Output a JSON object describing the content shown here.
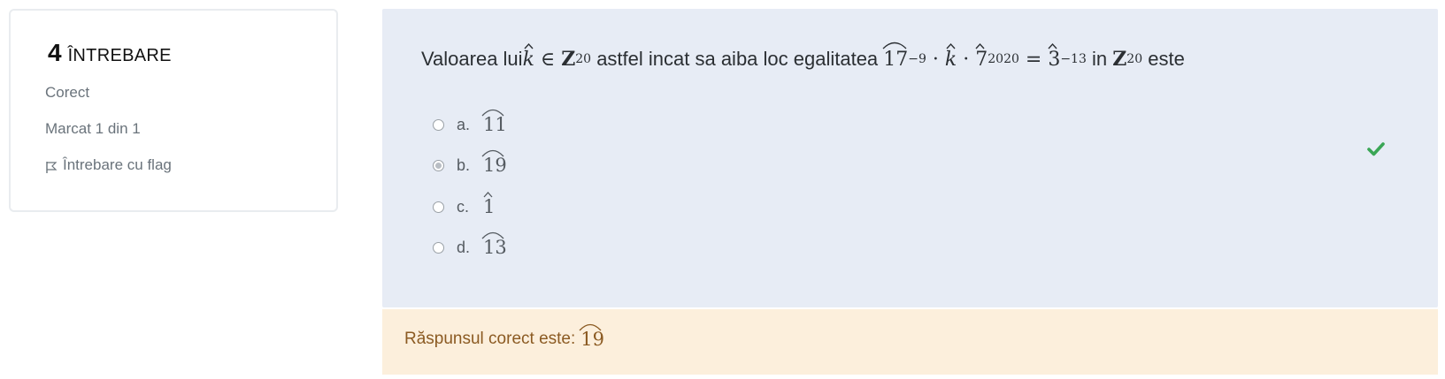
{
  "info": {
    "number": "4",
    "word": "ÎNTREBARE",
    "state": "Corect",
    "grade": "Marcat 1 din 1",
    "flag_label": "Întrebare cu flag"
  },
  "question": {
    "t1": "Valoarea lui ",
    "k": "k",
    "in": " ∈ ",
    "Z": "Z",
    "n20": "20",
    "t2": " astfel incat sa aiba loc egalitatea ",
    "b17": "17",
    "e9": "−9",
    "dot1": " · ",
    "k2": "k",
    "dot2": " · ",
    "b7": "7",
    "e2020": "2020",
    "eq": " = ",
    "b3": "3",
    "e13": "−13",
    "t3": " in ",
    "Z2": "Z",
    "n20b": "20",
    "t4": " este"
  },
  "answers": [
    {
      "letter": "a.",
      "value": "11",
      "selected": false
    },
    {
      "letter": "b.",
      "value": "19",
      "selected": true
    },
    {
      "letter": "c.",
      "value": "1",
      "selected": false
    },
    {
      "letter": "d.",
      "value": "13",
      "selected": false
    }
  ],
  "feedback": {
    "label": "Răspunsul corect este:",
    "value": "19"
  },
  "colors": {
    "formulation_bg": "#e7ecf5",
    "feedback_bg": "#fcefdc",
    "correct_icon": "#3aa655"
  },
  "icons": {
    "flag": "flag-icon",
    "correct": "check-icon"
  }
}
